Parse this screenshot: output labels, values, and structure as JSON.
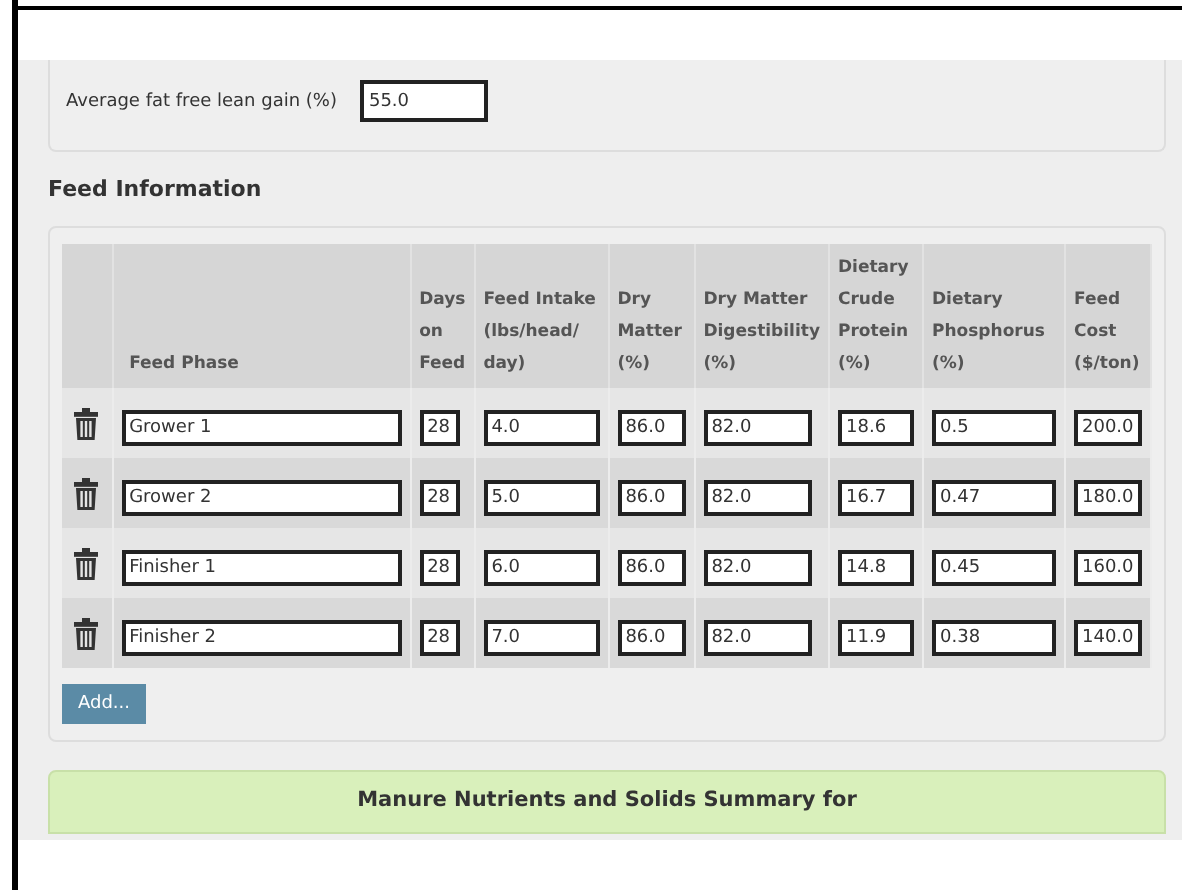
{
  "lean_gain": {
    "label": "Average fat free lean gain (%)",
    "value": "55.0"
  },
  "feed_section": {
    "title": "Feed Information",
    "columns": [
      "Feed Phase",
      "Days on Feed",
      "Feed Intake (lbs/head/ day)",
      "Dry Matter (%)",
      "Dry Matter Digestibility (%)",
      "Dietary Crude Protein (%)",
      "Dietary Phosphorus (%)",
      "Feed Cost ($/ton)"
    ],
    "rows": [
      {
        "values": [
          "Grower 1",
          "28",
          "4.0",
          "86.0",
          "82.0",
          "18.6",
          "0.5",
          "200.0"
        ]
      },
      {
        "values": [
          "Grower 2",
          "28",
          "5.0",
          "86.0",
          "82.0",
          "16.7",
          "0.47",
          "180.0"
        ]
      },
      {
        "values": [
          "Finisher 1",
          "28",
          "6.0",
          "86.0",
          "82.0",
          "14.8",
          "0.45",
          "160.0"
        ]
      },
      {
        "values": [
          "Finisher 2",
          "28",
          "7.0",
          "86.0",
          "82.0",
          "11.9",
          "0.38",
          "140.0"
        ]
      }
    ],
    "add_button": "Add..."
  },
  "summary_title": "Manure Nutrients and Solids Summary for"
}
